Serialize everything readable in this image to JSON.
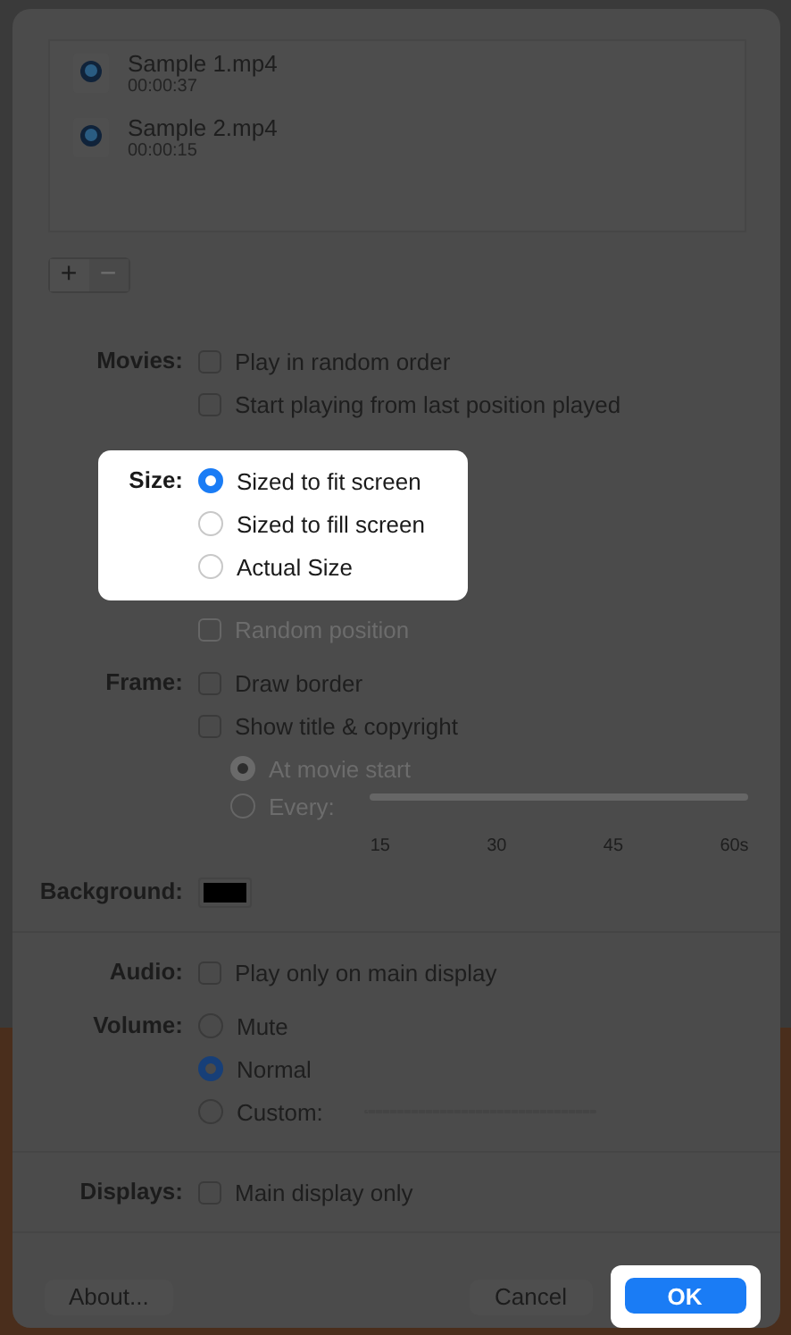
{
  "movies": [
    {
      "name": "Sample 1.mp4",
      "duration": "00:00:37"
    },
    {
      "name": "Sample 2.mp4",
      "duration": "00:00:15"
    }
  ],
  "list_buttons": [
    {
      "label": "+",
      "disabled": false
    },
    {
      "label": "−",
      "disabled": true
    }
  ],
  "groups": [
    {
      "label": "Movies:",
      "highlighted": false,
      "divider_after": false,
      "options": [
        {
          "kind": "checkbox",
          "text": "Play in random order",
          "checked": false,
          "disabled": false
        },
        {
          "kind": "checkbox",
          "text": "Start playing from last position played",
          "checked": false,
          "disabled": false
        }
      ]
    },
    {
      "label": "Size:",
      "highlighted": true,
      "divider_after": false,
      "options": [
        {
          "kind": "radio",
          "text": "Sized to fit screen",
          "selected": true
        },
        {
          "kind": "radio",
          "text": "Sized to fill screen",
          "selected": false
        },
        {
          "kind": "radio",
          "text": "Actual Size",
          "selected": false
        }
      ]
    },
    {
      "highlighted": false,
      "divider_after": false,
      "options": [
        {
          "kind": "checkbox",
          "text": "Random position",
          "checked": false,
          "disabled": true
        }
      ]
    },
    {
      "label": "Frame:",
      "highlighted": false,
      "divider_after": false,
      "options": [
        {
          "kind": "checkbox",
          "text": "Draw border",
          "checked": false,
          "disabled": false
        },
        {
          "kind": "checkbox",
          "text": "Show title & copyright",
          "checked": false,
          "disabled": false,
          "children": [
            {
              "kind": "radio",
              "text": "At movie start",
              "selected": true,
              "disabled": true
            },
            {
              "kind": "radio",
              "text": "Every:",
              "selected": false,
              "disabled": true,
              "slider": {
                "kind": "ticked",
                "ticks": [
                  "15",
                  "30",
                  "45",
                  "60s"
                ]
              }
            }
          ]
        }
      ]
    },
    {
      "label": "Background:",
      "highlighted": false,
      "divider_after": true,
      "options": [
        {
          "kind": "color",
          "color": "#000000"
        }
      ]
    },
    {
      "label": "Audio:",
      "highlighted": false,
      "divider_after": false,
      "options": [
        {
          "kind": "checkbox",
          "text": "Play only on main display",
          "checked": false,
          "disabled": false
        }
      ]
    },
    {
      "label": "Volume:",
      "highlighted": false,
      "divider_after": true,
      "options": [
        {
          "kind": "radio",
          "text": "Mute",
          "selected": false,
          "disabled": false
        },
        {
          "kind": "radio",
          "text": "Normal",
          "selected": true,
          "disabled": false
        },
        {
          "kind": "radio",
          "text": "Custom:",
          "selected": false,
          "disabled": false,
          "slider": {
            "kind": "dotted"
          }
        }
      ]
    },
    {
      "label": "Displays:",
      "highlighted": false,
      "divider_after": true,
      "options": [
        {
          "kind": "checkbox",
          "text": "Main display only",
          "checked": false,
          "disabled": false
        }
      ]
    }
  ],
  "buttons": [
    {
      "label": "About...",
      "kind": "plain",
      "highlighted": false
    },
    {
      "label": "Cancel",
      "kind": "plain",
      "highlighted": false
    },
    {
      "label": "OK",
      "kind": "default",
      "highlighted": true
    }
  ]
}
